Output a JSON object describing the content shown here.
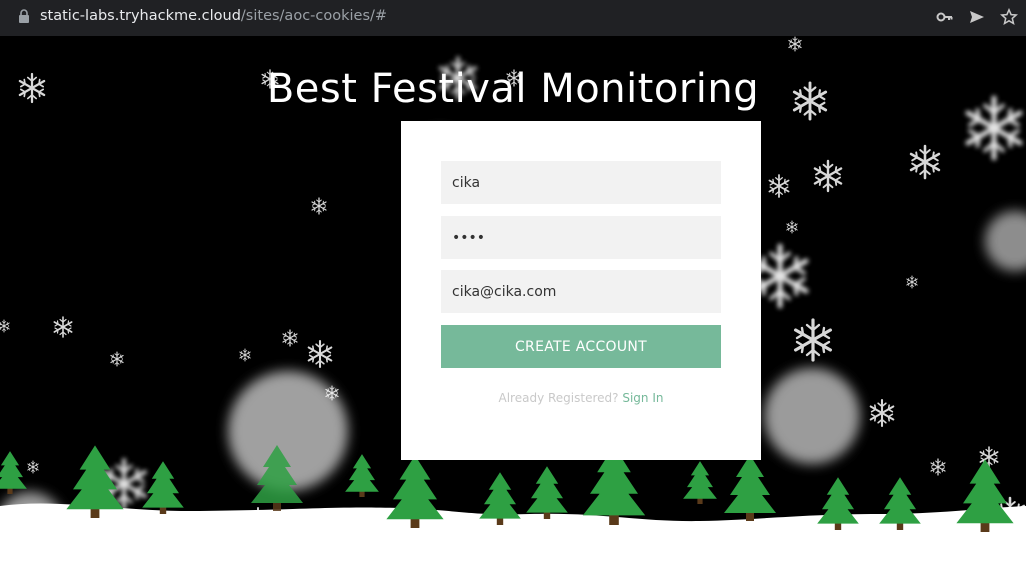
{
  "browser": {
    "url_host": "static-labs.tryhackme.cloud",
    "url_path": "/sites/aoc-cookies/#",
    "icons": [
      "lock-icon",
      "key-icon",
      "send-icon",
      "star-icon"
    ]
  },
  "page": {
    "title": "Best Festival Monitoring"
  },
  "form": {
    "username_value": "cika",
    "password_value": "cika",
    "email_value": "cika@cika.com",
    "submit_label": "CREATE ACCOUNT",
    "already_text": "Already Registered? ",
    "signin_link": "Sign In"
  },
  "colors": {
    "accent": "#76b99a",
    "tree": "#2ea043",
    "snow": "#ffffff",
    "background": "#000000"
  }
}
